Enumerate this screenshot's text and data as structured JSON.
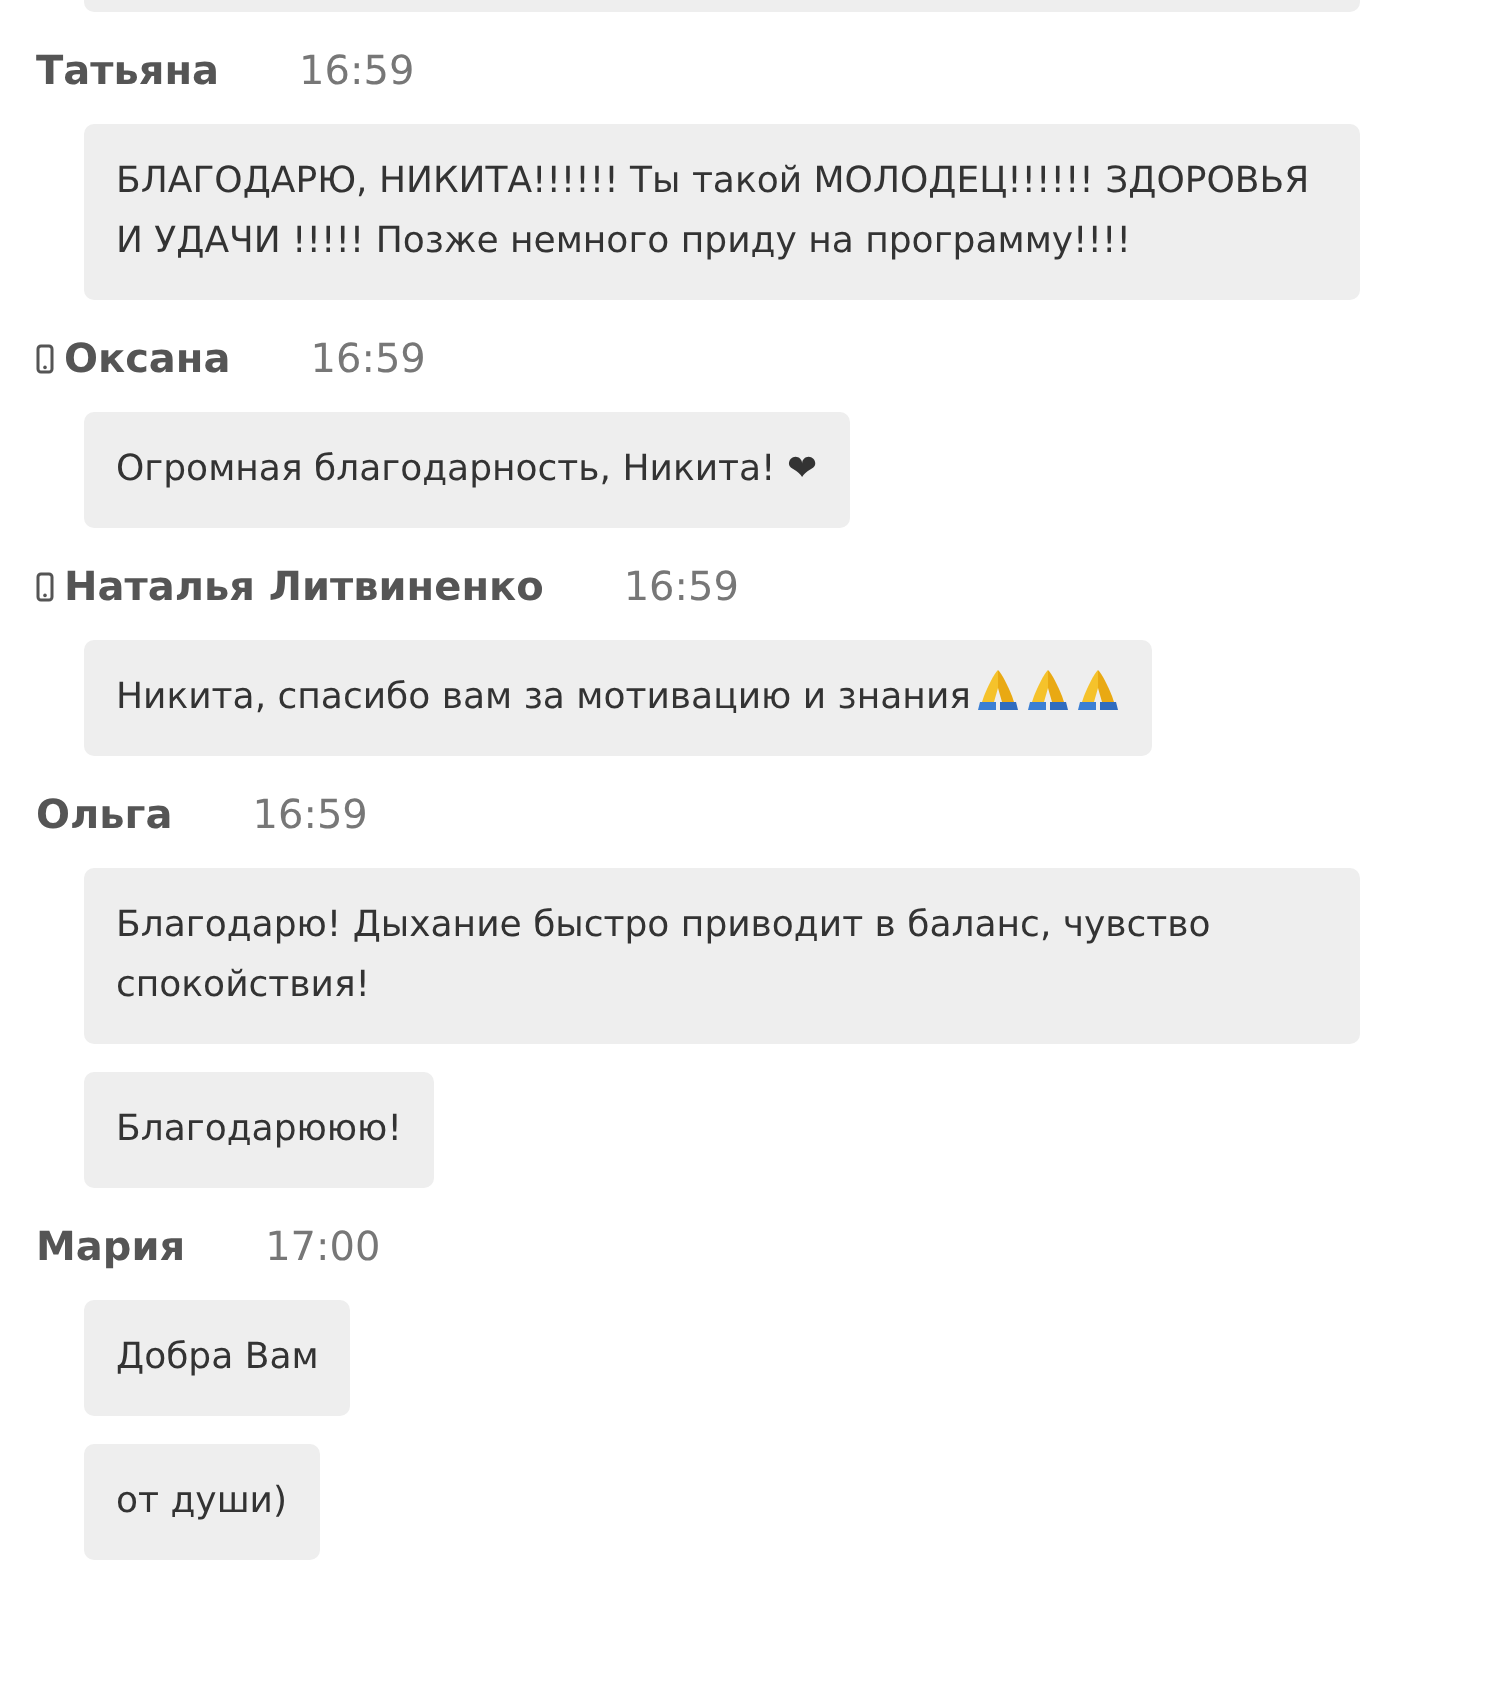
{
  "earlier_message_cut": true,
  "groups": [
    {
      "author": "Татьяна",
      "mobile": false,
      "time": "16:59",
      "messages": [
        {
          "text": "БЛАГОДАРЮ, НИКИТА!!!!!! Ты такой МОЛОДЕЦ!!!!!! ЗДОРОВЬЯ И УДАЧИ !!!!! Позже немного приду на программу!!!!"
        }
      ]
    },
    {
      "author": "Оксана",
      "mobile": true,
      "time": "16:59",
      "messages": [
        {
          "text": "Огромная благодарность, Никита! ❤"
        }
      ]
    },
    {
      "author": "Наталья Литвиненко",
      "mobile": true,
      "time": "16:59",
      "messages": [
        {
          "text": "Никита, спасибо вам за мотивацию и знания",
          "emoji": [
            {
              "kind": "pray"
            },
            {
              "kind": "pray"
            },
            {
              "kind": "pray"
            }
          ]
        }
      ]
    },
    {
      "author": "Ольга",
      "mobile": false,
      "time": "16:59",
      "messages": [
        {
          "text": "Благодарю! Дыхание быстро приводит в баланс, чувство спокойствия!"
        },
        {
          "text": "Благодарююю!"
        }
      ]
    },
    {
      "author": "Мария",
      "mobile": false,
      "time": "17:00",
      "messages": [
        {
          "text": "Добра Вам"
        },
        {
          "text": "от души)"
        }
      ]
    }
  ]
}
